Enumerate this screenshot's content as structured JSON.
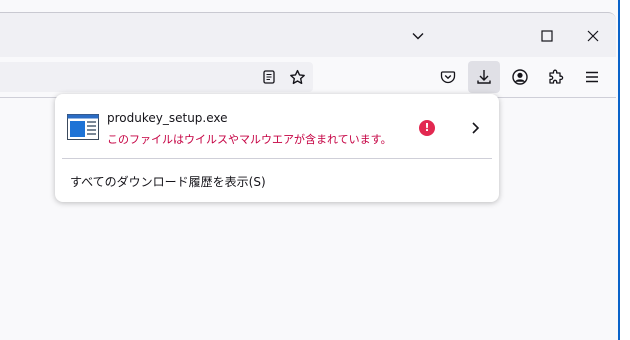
{
  "colors": {
    "accent": "#0a63c9",
    "warning_text": "#c50042",
    "warning_icon": "#e22850"
  },
  "titlebar": {
    "icons": [
      "chevron-down-icon",
      "maximize-icon",
      "close-icon"
    ]
  },
  "toolbar": {
    "urlbar_icons": [
      "reader-view-icon",
      "bookmark-star-icon"
    ],
    "icons": [
      "pocket-icon",
      "download-icon",
      "account-icon",
      "extensions-icon",
      "menu-icon"
    ]
  },
  "downloads_panel": {
    "item": {
      "file_name": "produkey_setup.exe",
      "warning": "このファイルはウイルスやマルウエアが含まれています。",
      "status_icon": "warning-icon",
      "action_icon": "chevron-right-icon"
    },
    "history_link": "すべてのダウンロード履歴を表示(S)"
  }
}
